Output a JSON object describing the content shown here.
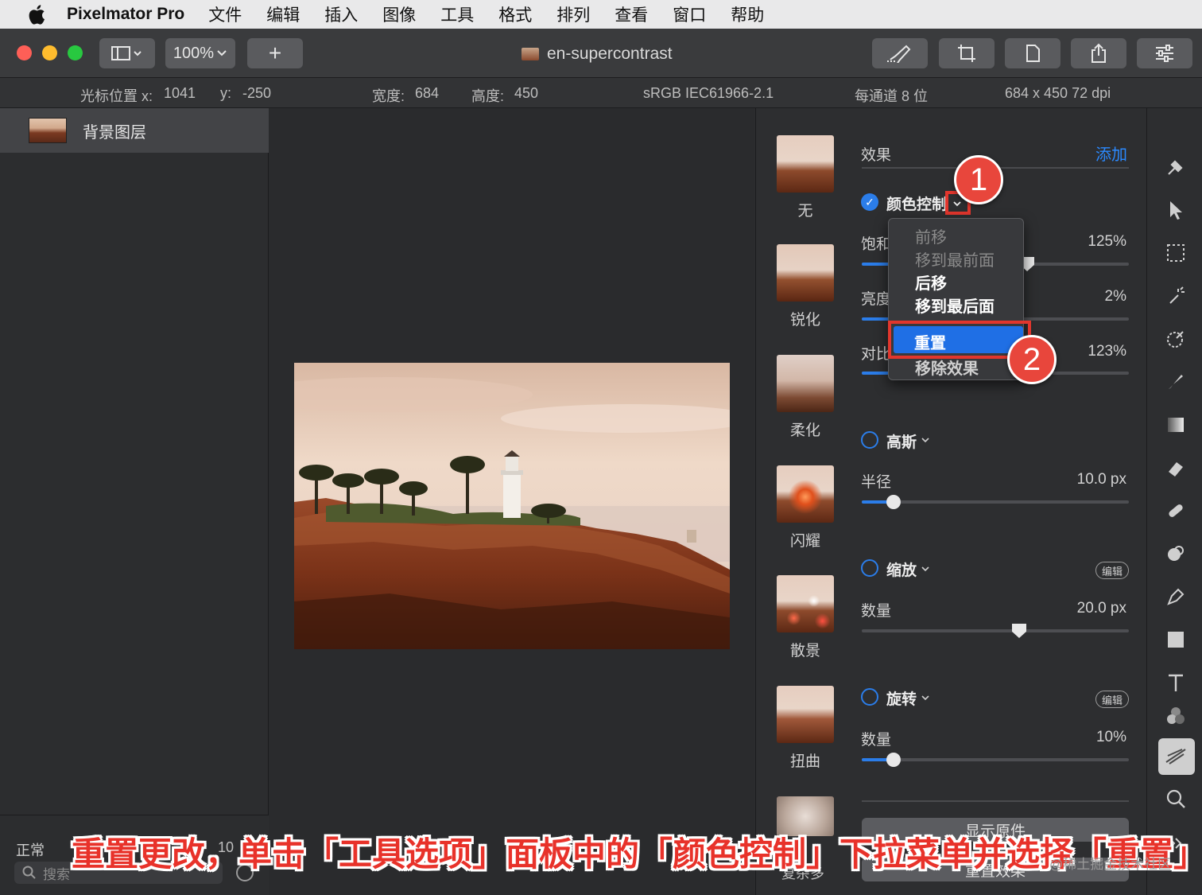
{
  "menubar": {
    "app_name": "Pixelmator Pro",
    "items": [
      "文件",
      "编辑",
      "插入",
      "图像",
      "工具",
      "格式",
      "排列",
      "查看",
      "窗口",
      "帮助"
    ]
  },
  "toolbar": {
    "zoom": "100%",
    "add_label": "+",
    "document_title": "en-supercontrast"
  },
  "infobar": {
    "cursor_label": "光标位置 x:",
    "cursor_x": "1041",
    "y_label": "y:",
    "cursor_y": "-250",
    "width_label": "宽度:",
    "width": "684",
    "height_label": "高度:",
    "height": "450",
    "color_profile": "sRGB IEC61966-2.1",
    "bit_depth": "每通道 8 位",
    "size_dpi": "684 x 450 72 dpi"
  },
  "layers": {
    "layer_name": "背景图层",
    "blend_mode": "正常",
    "opacity_partial": "10",
    "search_placeholder": "搜索"
  },
  "effects_browser": {
    "items": [
      "无",
      "锐化",
      "柔化",
      "闪耀",
      "散景",
      "扭曲"
    ],
    "partial_item": "复杂多"
  },
  "options": {
    "header": "效果",
    "add": "添加",
    "color_adjust": {
      "name": "颜色控制",
      "rows": [
        {
          "label": "饱和",
          "value": "125%",
          "level": 0.62
        },
        {
          "label": "亮度",
          "value": "2%",
          "level": 0.51
        },
        {
          "label": "对比",
          "value": "123%",
          "level": 0.6
        }
      ]
    },
    "gaussian": {
      "name": "高斯",
      "label": "半径",
      "value": "10.0 px",
      "level": 0.12
    },
    "zoom": {
      "name": "缩放",
      "edit": "编辑",
      "label": "数量",
      "value": "20.0 px",
      "level": 0.59
    },
    "twirl": {
      "name": "旋转",
      "edit": "编辑",
      "label": "数量",
      "value": "10%",
      "level": 0.12
    },
    "show_original": "显示原件",
    "reset_effects": "重置效果"
  },
  "dropdown": {
    "items": [
      "前移",
      "移到最前面",
      "后移",
      "移到最后面",
      "重置",
      "移除效果"
    ]
  },
  "annotations": {
    "step1": "1",
    "step2": "2",
    "caption": "重置更改，单击「工具选项」面板中的「颜色控制」下拉菜单并选择「重置」",
    "watermark": "@稀土掘金技术社区"
  },
  "colors": {
    "accent": "#2b7de9",
    "annotation_red": "#e8463c",
    "highlight": "#1f6fe5"
  }
}
